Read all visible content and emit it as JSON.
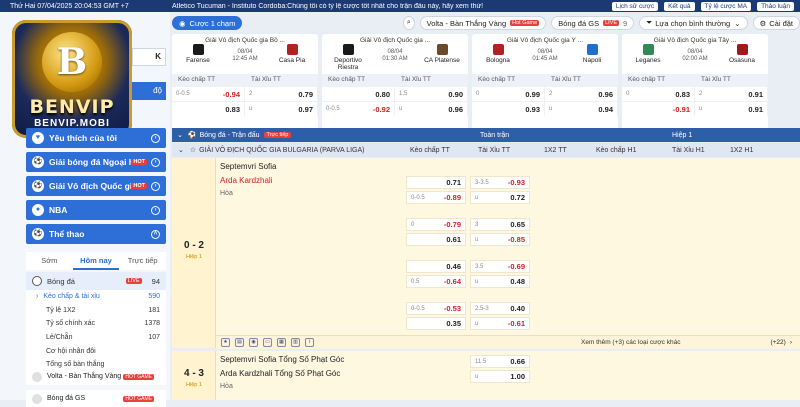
{
  "topbar": {
    "datetime": "Thứ Hai 07/04/2025 20:04:53 GMT +7",
    "ticker": "Atletico Tucuman - Instituto Cordoba:Chúng tôi có tỷ lệ cược tốt nhất cho trận đấu này, hãy xem thử!",
    "links": [
      "Lịch sử cược",
      "Kết quả",
      "Tỷ lệ cược MA",
      "Thảo luận"
    ]
  },
  "brand": {
    "logo_main": "BENVIP",
    "logo_sub": "BENVIP.MOBI",
    "coin": "B"
  },
  "account": {
    "balance_suffix": "K",
    "login_suffix": "độ"
  },
  "sidebar": {
    "favorites": "Yêu thích của tôi",
    "items": [
      {
        "label": "Giải bóng đá Ngoại hạn...",
        "hot": "HOT"
      },
      {
        "label": "Giải Vô địch Quốc gia Ý ...",
        "hot": "HOT"
      },
      {
        "label": "NBA",
        "hot": ""
      },
      {
        "label": "Thể thao",
        "hot": ""
      }
    ],
    "tabs": [
      "Sớm",
      "Hôm nay",
      "Trực tiếp"
    ],
    "sport": {
      "name": "Bóng đá",
      "live": "LIVE",
      "count": "94"
    },
    "subs": [
      {
        "label": "Kèo chấp & tài xỉu",
        "count": "590"
      },
      {
        "label": "Tỷ lệ 1X2",
        "count": "181"
      },
      {
        "label": "Tỷ số chính xác",
        "count": "1378"
      },
      {
        "label": "Lẻ/Chẵn",
        "count": "107"
      },
      {
        "label": "Cơ hội nhân đôi",
        "count": ""
      },
      {
        "label": "Tổng số bàn thắng",
        "count": ""
      }
    ],
    "bottom": [
      {
        "label": "Volta - Bàn Thắng Vàng",
        "hot": "HOT GAME"
      },
      {
        "label": "Bóng đá GS",
        "hot": "HOT GAME"
      }
    ]
  },
  "toolbar": {
    "bet1": "Cược 1 chạm",
    "volta": "Volta - Bàn Thắng Vàng",
    "volta_badge": "Hot Game",
    "gs": "Bóng đá GS",
    "gs_live": "LIVE",
    "gs_count": "9",
    "sort": "Lựa chọn bình thường",
    "settings": "Cài đặt"
  },
  "cards": [
    {
      "league": "Giải Vô địch Quốc gia Bồ ...",
      "date": "08/04",
      "time": "12:45 AM",
      "home": "Farense",
      "away": "Casa Pia",
      "hc": "#1a1a1a",
      "ac": "#b22222",
      "rows": [
        [
          "0-0.5",
          "-0.94",
          "2",
          "0.79"
        ],
        [
          "",
          "0.83",
          "u",
          "0.97"
        ]
      ]
    },
    {
      "league": "Giải Vô địch Quốc gia ...",
      "date": "08/04",
      "time": "01:30 AM",
      "home": "Deportivo Riestra",
      "away": "CA Platense",
      "hc": "#1a1a1a",
      "ac": "#6b4a2a",
      "rows": [
        [
          "",
          "0.80",
          "1.5",
          "0.90"
        ],
        [
          "0-0.5",
          "-0.92",
          "u",
          "0.96"
        ]
      ]
    },
    {
      "league": "Giải Vô địch Quốc gia Ý ...",
      "date": "08/04",
      "time": "01:45 AM",
      "home": "Bologna",
      "away": "Napoli",
      "hc": "#b22222",
      "ac": "#1e6fd0",
      "rows": [
        [
          "0",
          "0.99",
          "2",
          "0.96"
        ],
        [
          "",
          "0.93",
          "u",
          "0.94"
        ]
      ]
    },
    {
      "league": "Giải Vô địch Quốc gia Tây ...",
      "date": "08/04",
      "time": "02:00 AM",
      "home": "Leganes",
      "away": "Osasuna",
      "hc": "#2e8b57",
      "ac": "#a01a1a",
      "rows": [
        [
          "0",
          "0.83",
          "2",
          "0.91"
        ],
        [
          "",
          "-0.91",
          "u",
          "0.91"
        ]
      ]
    }
  ],
  "card_head": [
    "Kèo chấp TT",
    "Tài Xỉu TT"
  ],
  "section": {
    "sport_title": "Bóng đá - Trận đấu",
    "live_badge": "Trực tiếp",
    "full": "Toàn trận",
    "half": "Hiệp 1",
    "league": "GIẢI VÔ ĐỊCH QUỐC GIA BULGARIA (PARVA LIGA)",
    "cols": [
      "Kèo chấp TT",
      "Tài Xỉu TT",
      "1X2 TT",
      "Kèo chấp H1",
      "Tài Xỉu H1",
      "1X2 H1"
    ]
  },
  "match1": {
    "home": "Septemvri Sofia",
    "away": "Arda Kardzhali",
    "draw": "Hòa",
    "score": "0 - 2",
    "half": "Hiệp 1",
    "odds": [
      [
        "",
        "0.71",
        "3-3.5",
        "-0.93"
      ],
      [
        "0-0.5",
        "-0.89",
        "u",
        "0.72"
      ],
      [
        "0",
        "-0.79",
        "3",
        "0.65"
      ],
      [
        "",
        "0.61",
        "u",
        "-0.85"
      ],
      [
        "",
        "0.46",
        "3.5",
        "-0.69"
      ],
      [
        "0.5",
        "-0.64",
        "u",
        "0.48"
      ],
      [
        "0-0.5",
        "-0.53",
        "2.5-3",
        "0.40"
      ],
      [
        "",
        "0.35",
        "u",
        "-0.61"
      ]
    ],
    "more": "Xem thêm (+3) các loại cược khác",
    "plus": "(+22)"
  },
  "match2": {
    "home": "Septemvri Sofia Tổng Số Phạt Góc",
    "away": "Arda Kardzhali Tổng Số Phạt Góc",
    "draw": "Hòa",
    "score": "4 - 3",
    "half": "Hiệp 1",
    "odds": [
      [
        "11.5",
        "0.66"
      ],
      [
        "u",
        "1.00"
      ]
    ]
  },
  "colors": {
    "primary": "#2d6fd6",
    "navy": "#1b3a73",
    "negative": "#d32020",
    "highlight": "#fff8e1"
  }
}
